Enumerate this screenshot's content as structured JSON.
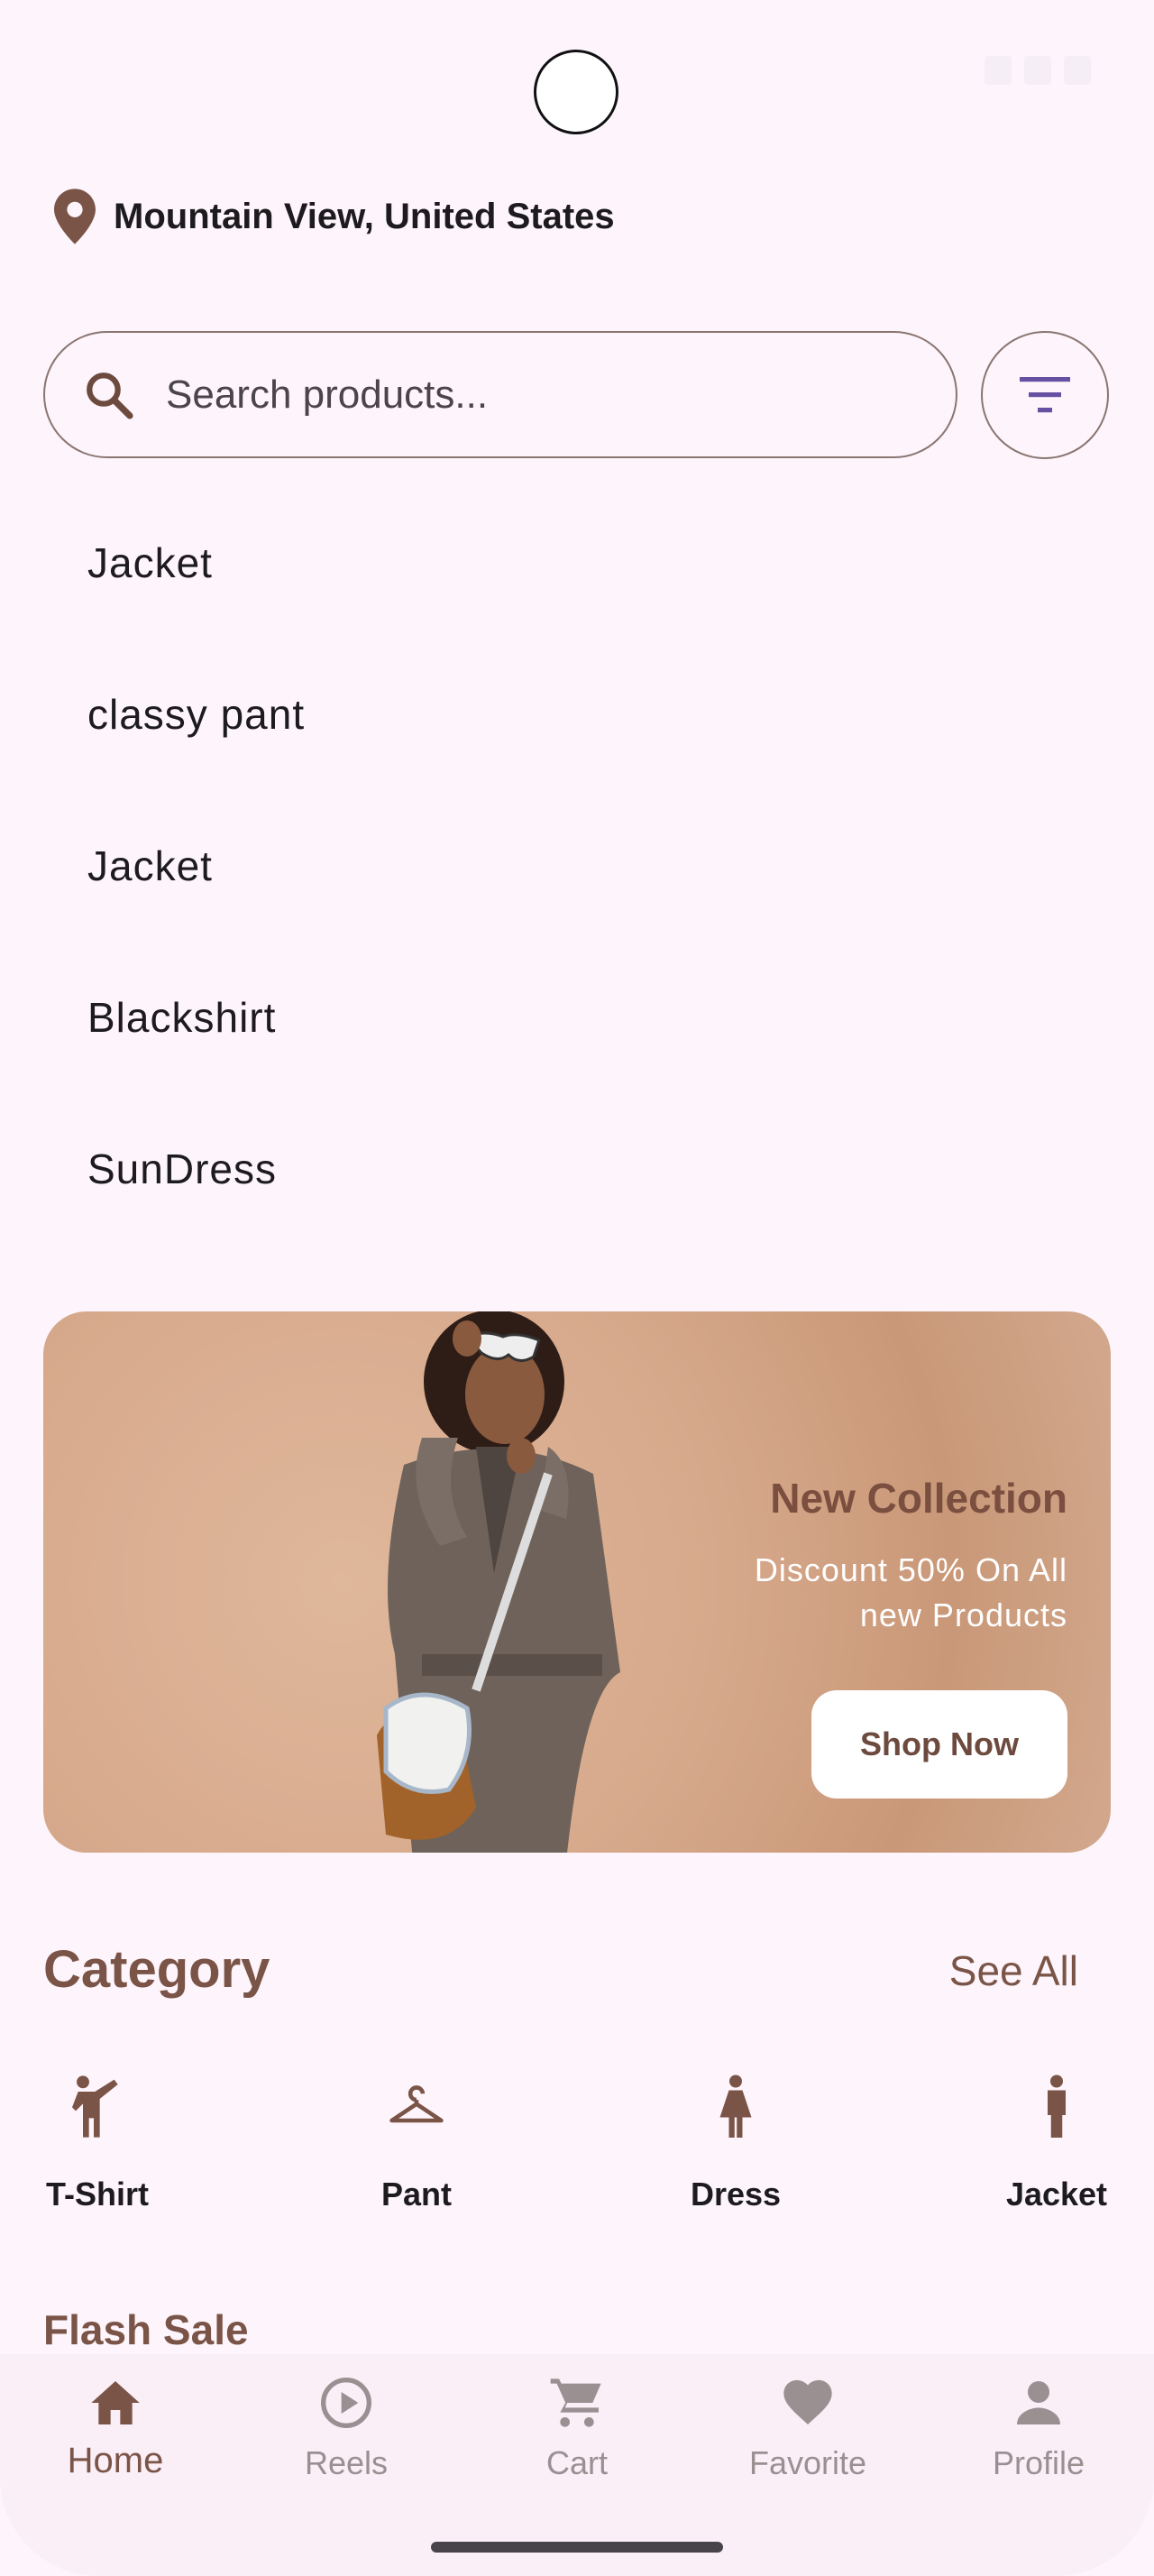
{
  "location": {
    "text": "Mountain View, United States"
  },
  "search": {
    "placeholder": "Search products..."
  },
  "suggestions": [
    "Jacket",
    "classy pant",
    "Jacket",
    "Blackshirt",
    "SunDress"
  ],
  "banner": {
    "title": "New Collection",
    "subtitle": "Discount 50% On All new Products",
    "button_label": "Shop Now"
  },
  "category": {
    "title": "Category",
    "see_all": "See All",
    "items": [
      {
        "label": "T-Shirt",
        "icon": "person-pose-icon"
      },
      {
        "label": "Pant",
        "icon": "hanger-icon"
      },
      {
        "label": "Dress",
        "icon": "woman-icon"
      },
      {
        "label": "Jacket",
        "icon": "man-icon"
      }
    ]
  },
  "flash_sale": {
    "title": "Flash Sale"
  },
  "nav": {
    "items": [
      {
        "label": "Home",
        "icon": "home-icon",
        "active": true
      },
      {
        "label": "Reels",
        "icon": "play-circle-icon",
        "active": false
      },
      {
        "label": "Cart",
        "icon": "cart-icon",
        "active": false
      },
      {
        "label": "Favorite",
        "icon": "heart-icon",
        "active": false
      },
      {
        "label": "Profile",
        "icon": "person-icon",
        "active": false
      }
    ]
  },
  "colors": {
    "accent": "#7b5448",
    "background": "#fdf5fb",
    "filter_icon": "#6750a4"
  }
}
